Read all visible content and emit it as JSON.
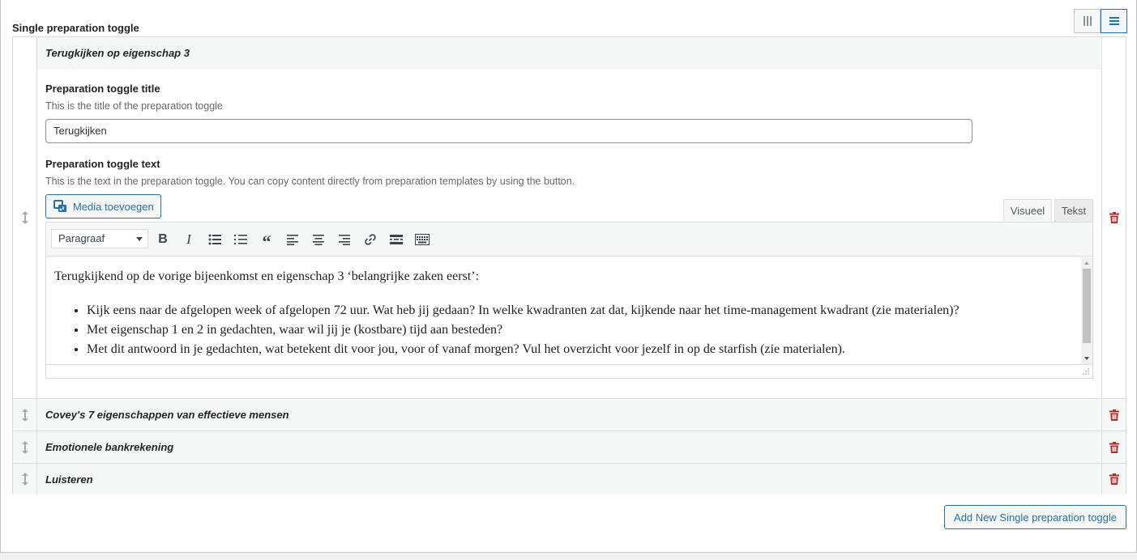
{
  "field": {
    "label": "Single preparation toggle"
  },
  "rows": [
    {
      "title": "Terugkijken op eigenschap 3",
      "expanded": true
    },
    {
      "title": "Covey's 7 eigenschappen van effectieve mensen"
    },
    {
      "title": "Emotionele bankrekening"
    },
    {
      "title": "Luisteren"
    }
  ],
  "expanded_row": {
    "title_field": {
      "label": "Preparation toggle title",
      "description": "This is the title of the preparation toggle",
      "value": "Terugkijken"
    },
    "text_field": {
      "label": "Preparation toggle text",
      "description": "This is the text in the preparation toggle. You can copy content directly from preparation templates by using the button."
    },
    "editor": {
      "media_button": "Media toevoegen",
      "tabs": {
        "visual": "Visueel",
        "text": "Tekst"
      },
      "format_select": "Paragraaf",
      "content": {
        "paragraph": "Terugkijkend op de vorige bijeenkomst en eigenschap 3 ‘belangrijke zaken eerst’:",
        "bullets": [
          "Kijk eens naar de afgelopen week of afgelopen 72 uur. Wat heb jij gedaan? In welke kwadranten zat dat, kijkende naar het time-management kwadrant (zie materialen)?",
          "Met eigenschap 1 en 2 in gedachten, waar wil jij je (kostbare) tijd aan besteden?",
          "Met dit antwoord in je gedachten, wat betekent dit voor jou, voor of vanaf morgen? Vul het overzicht voor jezelf in op de starfish (zie materialen)."
        ]
      }
    }
  },
  "add_button": "Add New Single preparation toggle",
  "colors": {
    "accent": "#2271b1",
    "danger": "#b32d2e",
    "border": "#dcdcde"
  }
}
